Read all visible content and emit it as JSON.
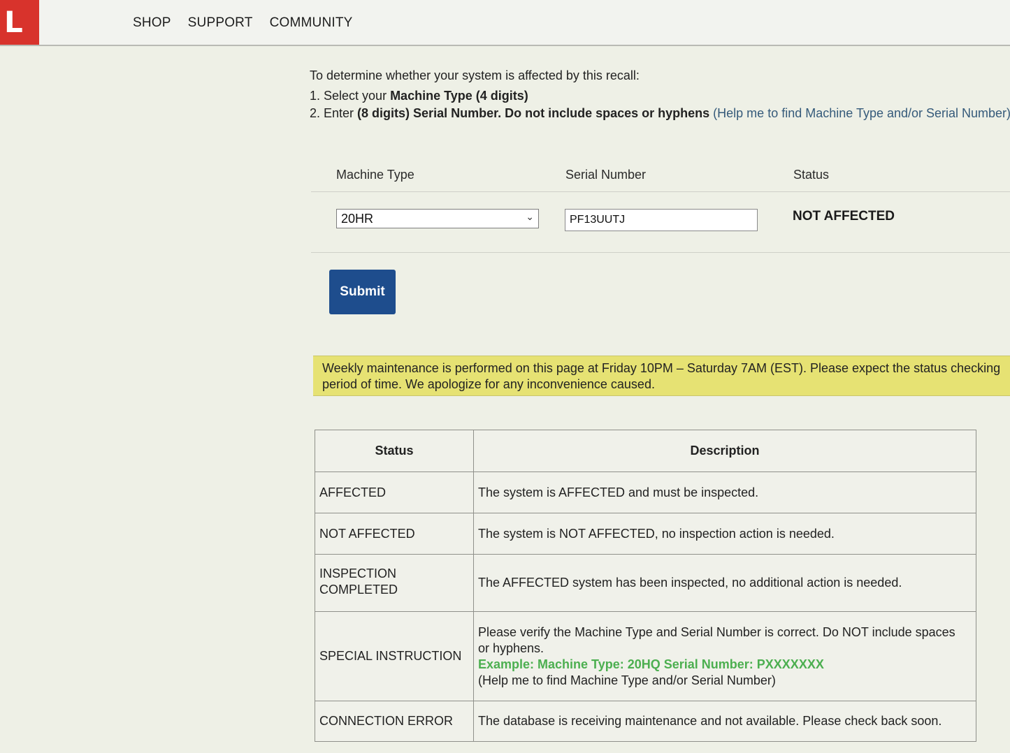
{
  "header": {
    "logo_letter": "L",
    "nav": [
      "SHOP",
      "SUPPORT",
      "COMMUNITY"
    ]
  },
  "intro": {
    "lead": "To determine whether your system is affected by this recall:",
    "step1_prefix": "1. Select your ",
    "step1_bold": "Machine Type (4 digits)",
    "step2_prefix": "2. Enter ",
    "step2_bold": "(8 digits) Serial Number. Do not include spaces or hyphens",
    "step2_link": "(Help me to find Machine Type and/or Serial Number)"
  },
  "form": {
    "headers": {
      "machine_type": "Machine Type",
      "serial_number": "Serial Number",
      "status": "Status"
    },
    "machine_type_value": "20HR",
    "serial_number_value": "PF13UUTJ",
    "status_value": "NOT AFFECTED",
    "submit_label": "Submit"
  },
  "notice": {
    "line1": "Weekly maintenance is performed on this page at Friday 10PM – Saturday 7AM (EST). Please expect the status checking",
    "line2": "period of time. We apologize for any inconvenience caused."
  },
  "status_table": {
    "headers": [
      "Status",
      "Description"
    ],
    "rows": [
      {
        "status": "AFFECTED",
        "description": "The system is AFFECTED and must be inspected."
      },
      {
        "status": "NOT AFFECTED",
        "description": "The system is NOT AFFECTED, no inspection action is needed."
      },
      {
        "status_line1": "INSPECTION",
        "status_line2": "COMPLETED",
        "description": "The AFFECTED system has been inspected, no additional action is needed."
      },
      {
        "status": "SPECIAL INSTRUCTION",
        "description_line1": "Please verify the Machine Type and Serial Number is correct. Do NOT include spaces",
        "description_line2": "or hyphens.",
        "example": "Example: Machine Type: 20HQ Serial Number: PXXXXXXX",
        "help": "(Help me to find Machine Type and/or Serial Number)"
      },
      {
        "status": "CONNECTION ERROR",
        "description": "The database is receiving maintenance and not available. Please check back soon."
      }
    ]
  },
  "colors": {
    "logo": "#d8332c",
    "submit": "#1e4d8d",
    "notice": "#e6e273",
    "example_text": "#4caf50"
  }
}
